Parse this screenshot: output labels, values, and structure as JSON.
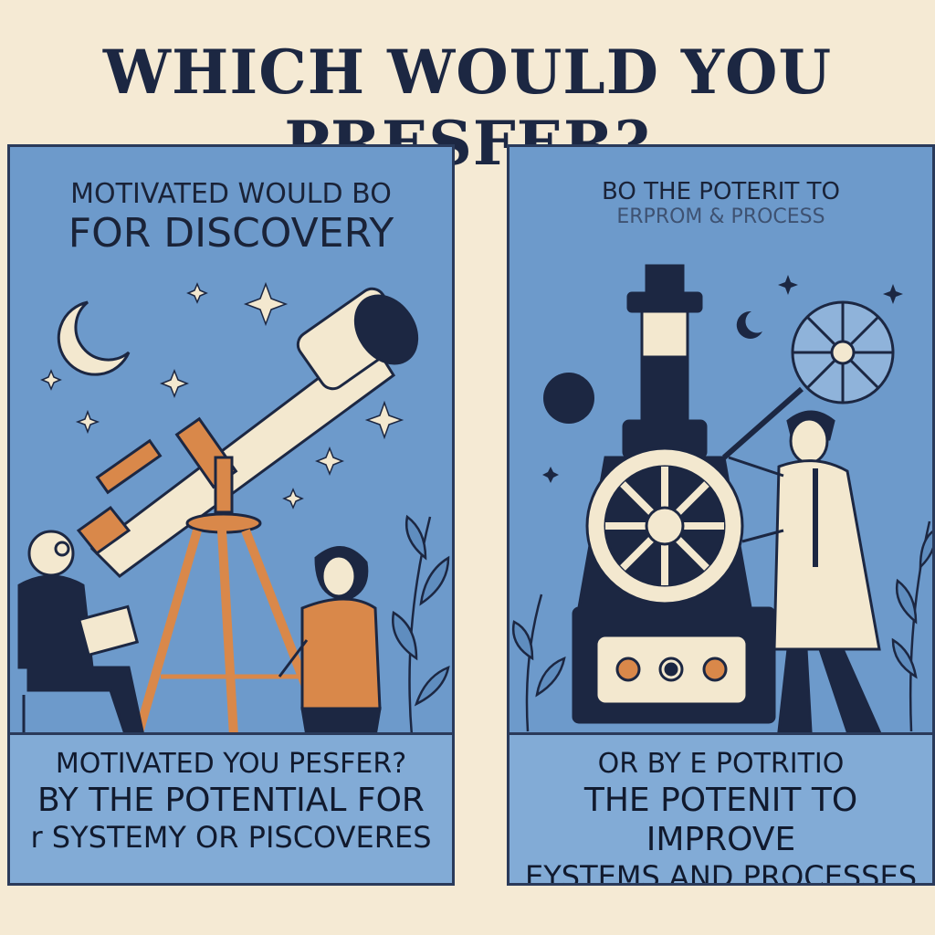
{
  "title": "WHICH WOULD YOU PRESFER?",
  "left_panel": {
    "top_line1": "MOTIVATED WOULD BO",
    "top_line2": "FOR DISCOVERY",
    "bottom_line1": "MOTIVATED YOU    PESFER?",
    "bottom_line2": "BY THE POTENTIAL FOR",
    "bottom_line3": "r SYSTEMY OR PISCOVERES"
  },
  "right_panel": {
    "top_line1": "BO THE POTERIT TO",
    "top_line2": "ERPROM & PROCESS",
    "bottom_line1": "OR BY E POTRITIO",
    "bottom_line2": "THE POTENIT TO IMPROVE",
    "bottom_line3": "EYSTEMS AND PROCESSES"
  },
  "colors": {
    "background": "#f5ead4",
    "panel": "#6d9acb",
    "ink": "#1c2742",
    "accent_orange": "#d9884a",
    "cream": "#f3e8cf"
  }
}
